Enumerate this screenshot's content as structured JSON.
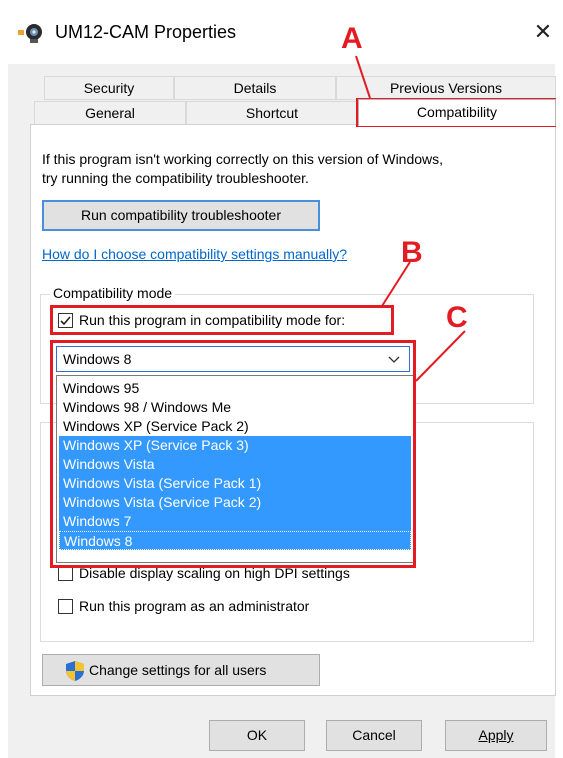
{
  "window": {
    "title": "UM12-CAM Properties",
    "close_glyph": "✕"
  },
  "tabs": {
    "row1": [
      "Security",
      "Details",
      "Previous Versions"
    ],
    "row2": [
      "General",
      "Shortcut",
      "Compatibility"
    ],
    "active": "Compatibility"
  },
  "content": {
    "intro_line1": "If this program isn't working correctly on this version of Windows,",
    "intro_line2": "try running the compatibility troubleshooter.",
    "troubleshooter_button": "Run compatibility troubleshooter",
    "manual_link": "How do I choose compatibility settings manually?",
    "compat_group_label": "Compatibility mode",
    "compat_checkbox_label": "Run this program in compatibility mode for:",
    "compat_checkbox_checked": true,
    "compat_select_value": "Windows 8",
    "compat_options": [
      "Windows 95",
      "Windows 98 / Windows Me",
      "Windows XP (Service Pack 2)",
      "Windows XP (Service Pack 3)",
      "Windows Vista",
      "Windows Vista (Service Pack 1)",
      "Windows Vista (Service Pack 2)",
      "Windows 7",
      "Windows 8"
    ],
    "dpi_checkbox_label": "Disable display scaling on high DPI settings",
    "admin_checkbox_label": "Run this program as an administrator",
    "all_users_button": "Change settings for all users"
  },
  "footer": {
    "ok": "OK",
    "cancel": "Cancel",
    "apply": "Apply"
  },
  "annotations": {
    "a": "A",
    "b": "B",
    "c": "C",
    "color": "#e31b23"
  },
  "colors": {
    "highlight": "#3399ff",
    "link": "#0066cc"
  }
}
